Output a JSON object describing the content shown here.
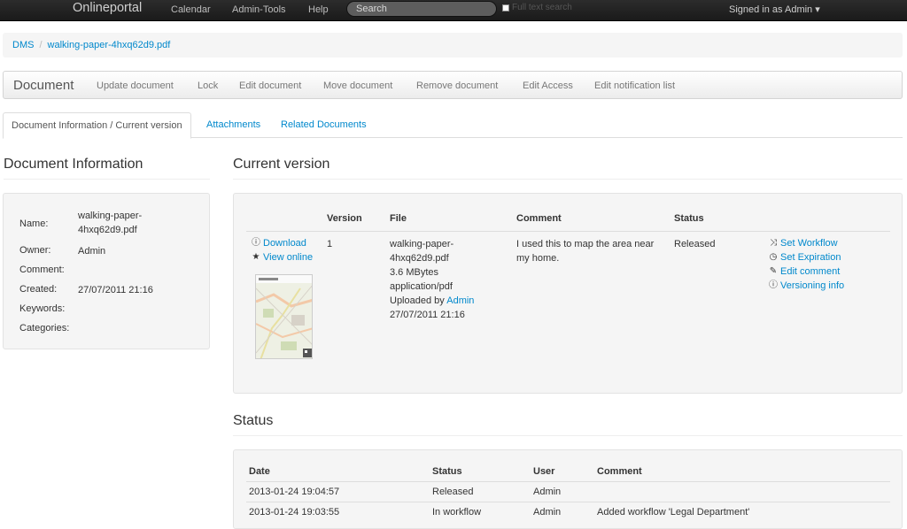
{
  "navbar": {
    "brand": "Onlineportal",
    "links": [
      "Calendar",
      "Admin-Tools",
      "Help"
    ],
    "search_placeholder": "Search",
    "fulltext_label": "Full text search",
    "signed_in": "Signed in as Admin ▾"
  },
  "breadcrumb": {
    "root": "DMS",
    "separator": "/",
    "current": "walking-paper-4hxq62d9.pdf"
  },
  "doc_bar": {
    "title": "Document",
    "items": [
      "Update document",
      "Lock",
      "Edit document",
      "Move document",
      "Remove document",
      "Edit Access",
      "Edit notification list"
    ]
  },
  "tabs": {
    "active": "Document Information / Current version",
    "attachments": "Attachments",
    "related": "Related Documents"
  },
  "info": {
    "heading": "Document Information",
    "labels": {
      "name": "Name:",
      "owner": "Owner:",
      "comment": "Comment:",
      "created": "Created:",
      "keywords": "Keywords:",
      "categories": "Categories:"
    },
    "name_line1": "walking-paper-",
    "name_line2": "4hxq62d9.pdf",
    "owner": "Admin",
    "created": "27/07/2011 21:16"
  },
  "current_version": {
    "heading": "Current version",
    "headers": {
      "version": "Version",
      "file": "File",
      "comment": "Comment",
      "status": "Status"
    },
    "download": "Download",
    "view_online": "View online",
    "version": "1",
    "file_lines": [
      "walking-paper-",
      "4hxq62d9.pdf",
      "3.6 MBytes",
      "application/pdf"
    ],
    "uploaded_by": "Uploaded by",
    "uploader": "Admin",
    "uploaded_date": "27/07/2011 21:16",
    "comment_line1": "I used this to map the area near",
    "comment_line2": "my home.",
    "status": "Released",
    "actions": [
      "Set Workflow",
      "Set Expiration",
      "Edit comment",
      "Versioning info"
    ]
  },
  "status": {
    "heading": "Status",
    "headers": {
      "date": "Date",
      "status": "Status",
      "user": "User",
      "comment": "Comment"
    },
    "rows": [
      {
        "date": "2013-01-24 19:04:57",
        "status": "Released",
        "user": "Admin",
        "comment": ""
      },
      {
        "date": "2013-01-24 19:03:55",
        "status": "In workflow",
        "user": "Admin",
        "comment": "Added workflow 'Legal Department'"
      }
    ]
  }
}
